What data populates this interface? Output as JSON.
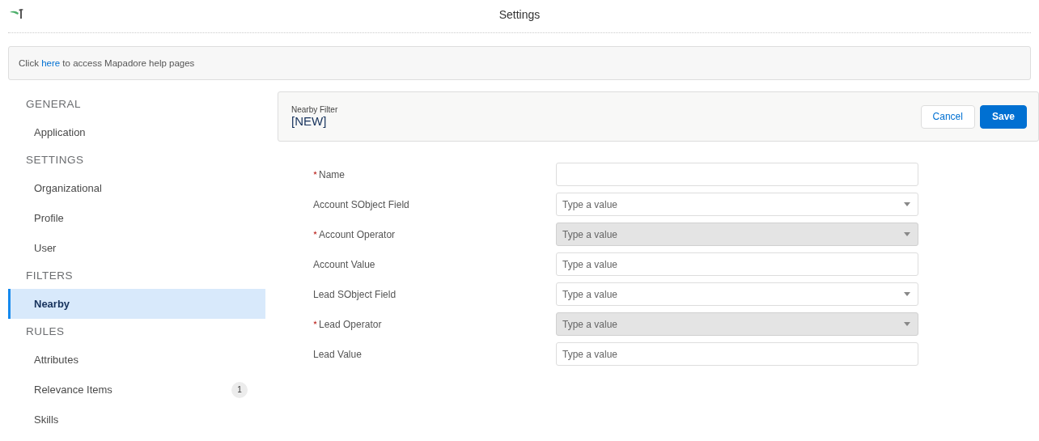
{
  "header": {
    "title": "Settings"
  },
  "help": {
    "before": "Click ",
    "link": "here",
    "after": " to access Mapadore help pages"
  },
  "sidebar": {
    "sections": [
      {
        "heading": "GENERAL",
        "items": [
          {
            "label": "Application",
            "selected": false
          }
        ]
      },
      {
        "heading": "SETTINGS",
        "items": [
          {
            "label": "Organizational",
            "selected": false
          },
          {
            "label": "Profile",
            "selected": false
          },
          {
            "label": "User",
            "selected": false
          }
        ]
      },
      {
        "heading": "FILTERS",
        "items": [
          {
            "label": "Nearby",
            "selected": true
          }
        ]
      },
      {
        "heading": "RULES",
        "items": [
          {
            "label": "Attributes",
            "selected": false
          },
          {
            "label": "Relevance Items",
            "selected": false,
            "badge": "1"
          },
          {
            "label": "Skills",
            "selected": false
          }
        ]
      }
    ]
  },
  "panel": {
    "subtitle": "Nearby Filter",
    "title": "[NEW]",
    "buttons": [
      {
        "label": "Cancel",
        "kind": "neutral"
      },
      {
        "label": "Save",
        "kind": "brand"
      }
    ]
  },
  "form": [
    {
      "label": "Name",
      "required": true,
      "kind": "text",
      "disabled": false
    },
    {
      "label": "Account SObject Field",
      "required": false,
      "kind": "combobox",
      "disabled": false,
      "placeholder": "Type a value"
    },
    {
      "label": "Account Operator",
      "required": true,
      "kind": "combobox",
      "disabled": true,
      "placeholder": "Type a value"
    },
    {
      "label": "Account Value",
      "required": false,
      "kind": "text",
      "disabled": false,
      "placeholder": "Type a value"
    },
    {
      "label": "Lead SObject Field",
      "required": false,
      "kind": "combobox",
      "disabled": false,
      "placeholder": "Type a value"
    },
    {
      "label": "Lead Operator",
      "required": true,
      "kind": "combobox",
      "disabled": true,
      "placeholder": "Type a value"
    },
    {
      "label": "Lead Value",
      "required": false,
      "kind": "text",
      "disabled": false,
      "placeholder": "Type a value"
    }
  ]
}
